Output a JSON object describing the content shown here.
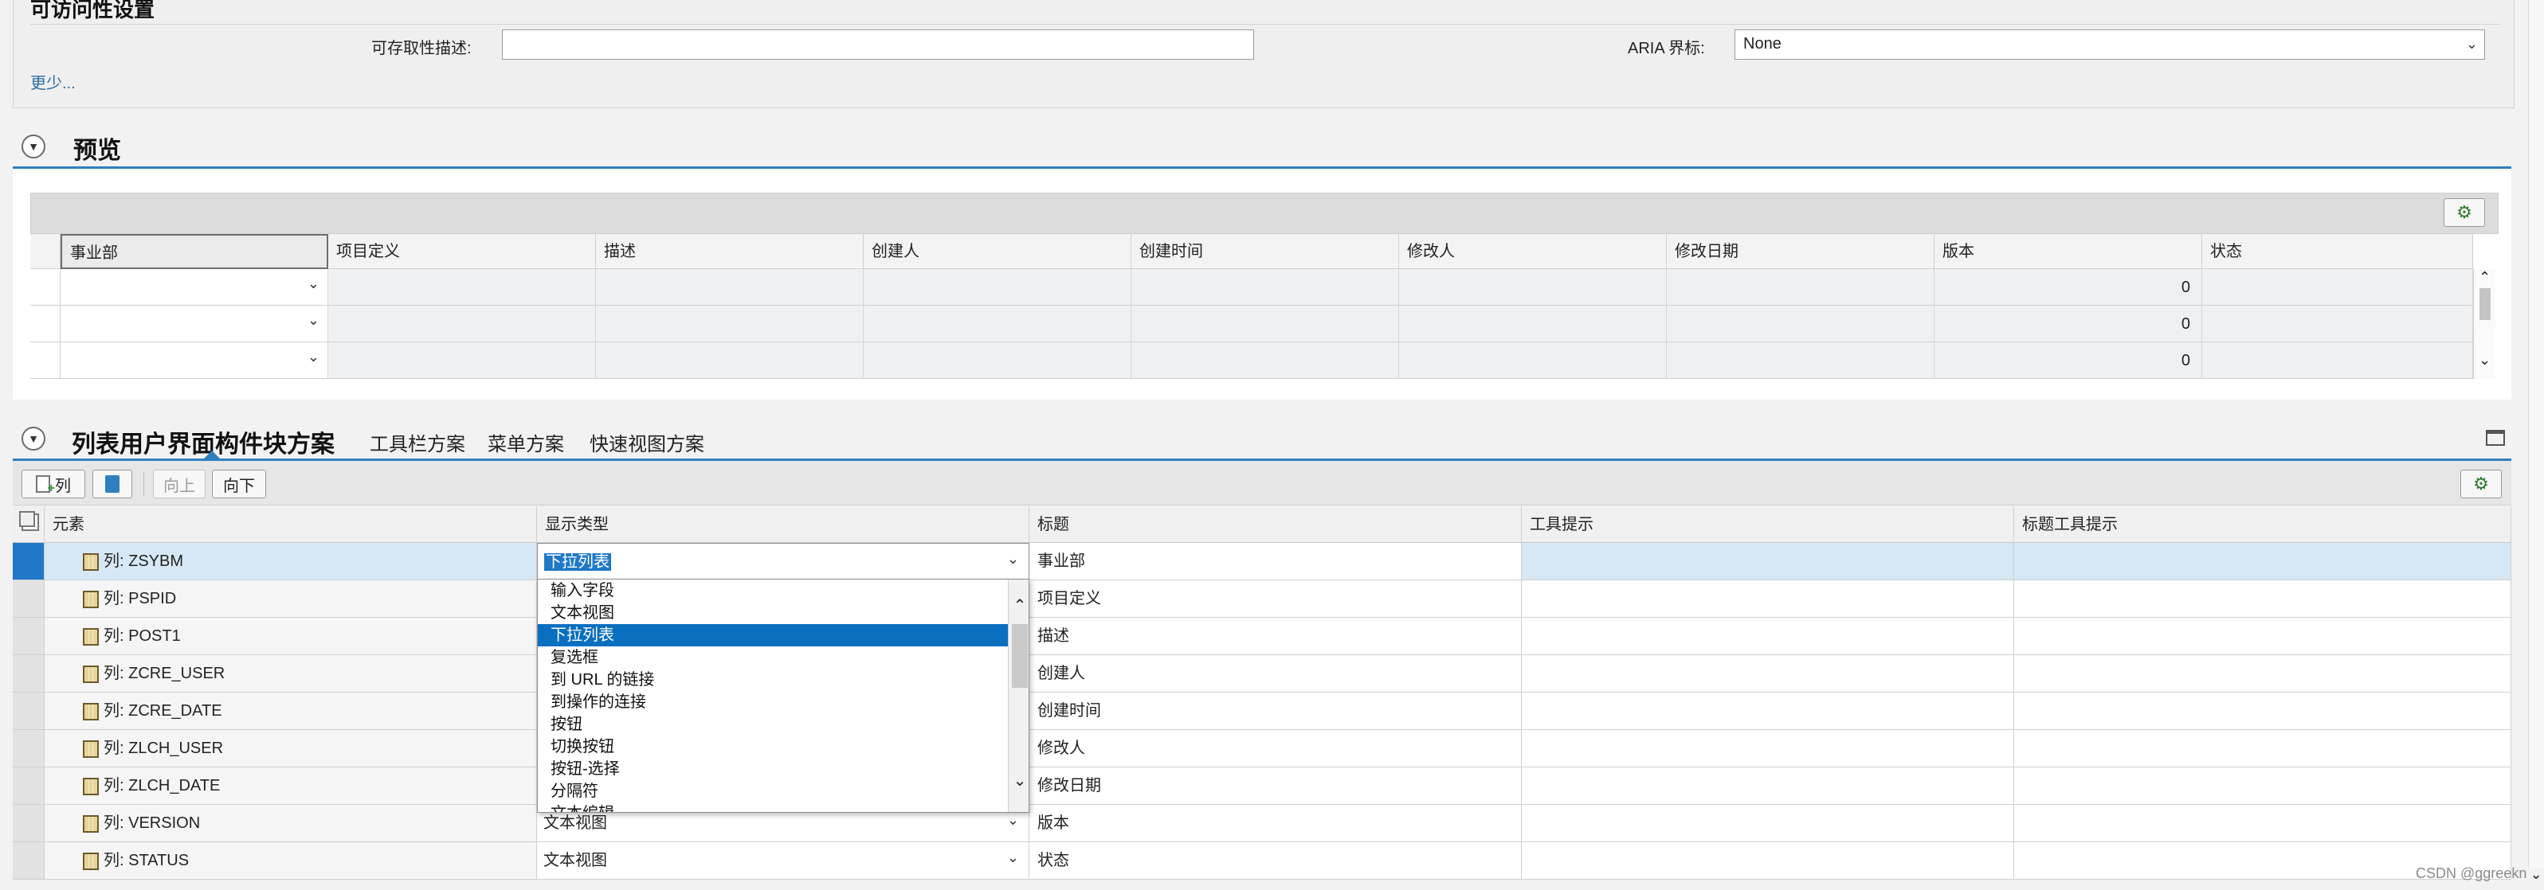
{
  "accessibility": {
    "title": "可访问性设置",
    "desc_label": "可存取性描述:",
    "desc_value": "",
    "aria_label": "ARIA 界标:",
    "aria_value": "None",
    "more_link": "更少..."
  },
  "preview": {
    "title": "预览",
    "columns": [
      "事业部",
      "项目定义",
      "描述",
      "创建人",
      "创建时间",
      "修改人",
      "修改日期",
      "版本",
      "状态"
    ],
    "rows": [
      {
        "version": "0"
      },
      {
        "version": "0"
      },
      {
        "version": "0"
      }
    ]
  },
  "scheme": {
    "title": "列表用户界面构件块方案",
    "tabs": [
      "工具栏方案",
      "菜单方案",
      "快速视图方案"
    ],
    "toolbar": {
      "column_button": "列",
      "up_button": "向上",
      "down_button": "向下"
    },
    "columns": [
      "元素",
      "显示类型",
      "标题",
      "工具提示",
      "标题工具提示"
    ],
    "rows": [
      {
        "element": "列: ZSYBM",
        "display": "下拉列表",
        "title": "事业部"
      },
      {
        "element": "列: PSPID",
        "display": "",
        "title": "项目定义"
      },
      {
        "element": "列: POST1",
        "display": "",
        "title": "描述"
      },
      {
        "element": "列: ZCRE_USER",
        "display": "",
        "title": "创建人"
      },
      {
        "element": "列: ZCRE_DATE",
        "display": "",
        "title": "创建时间"
      },
      {
        "element": "列: ZLCH_USER",
        "display": "",
        "title": "修改人"
      },
      {
        "element": "列: ZLCH_DATE",
        "display": "",
        "title": "修改日期"
      },
      {
        "element": "列: VERSION",
        "display": "文本视图",
        "title": "版本"
      },
      {
        "element": "列: STATUS",
        "display": "文本视图",
        "title": "状态"
      }
    ]
  },
  "dropdown": {
    "options": [
      "输入字段",
      "文本视图",
      "下拉列表",
      "复选框",
      "到 URL 的链接",
      "到操作的连接",
      "按钮",
      "切换按钮",
      "按钮-选择",
      "分隔符",
      "文本编辑"
    ],
    "selected_index": 2
  },
  "watermark": "CSDN @ggreekn"
}
